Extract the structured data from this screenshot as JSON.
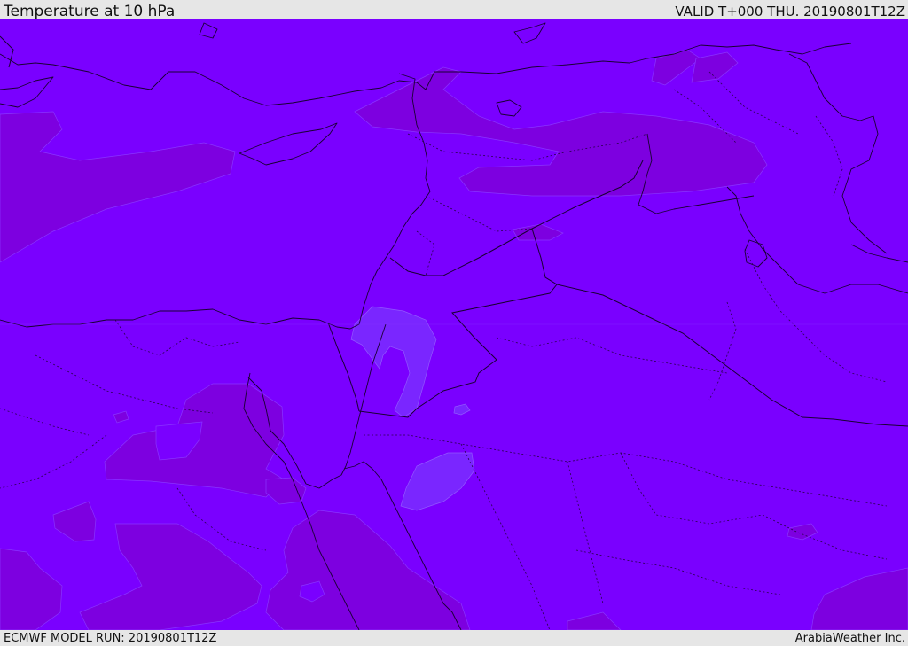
{
  "header": {
    "title": "Temperature at 10 hPa",
    "valid": "VALID T+000 THU. 20190801T12Z"
  },
  "footer": {
    "model_run": "ECMWF MODEL RUN: 20190801T12Z",
    "credit": "ArabiaWeather Inc."
  },
  "colors": {
    "base_field": "#7a00ff",
    "warm_band": "#7d00e0",
    "cool_band": "#7a26ff",
    "borders": "#1a0033",
    "ui_bar": "#e6e6e6"
  }
}
